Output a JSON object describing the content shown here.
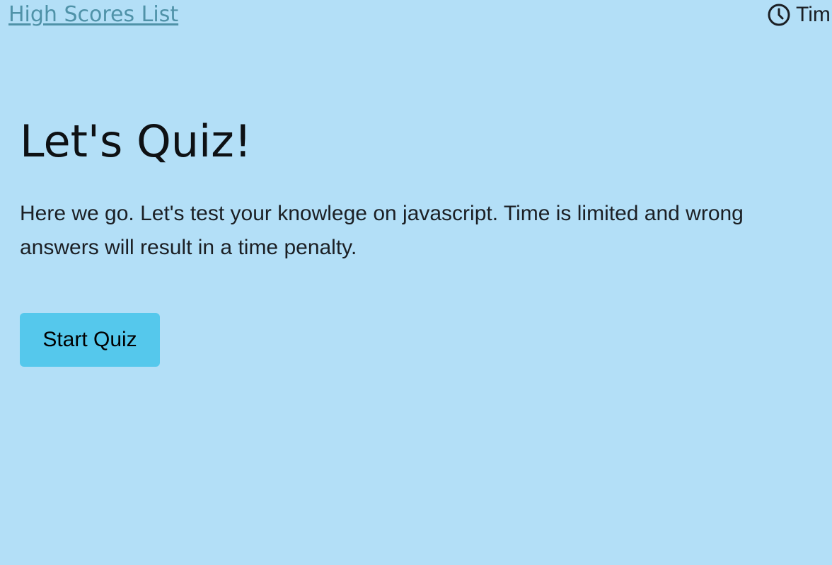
{
  "header": {
    "high_scores_label": "High Scores List",
    "timer_icon": "clock-icon",
    "timer_label": "Tim"
  },
  "main": {
    "title": "Let's Quiz!",
    "intro": "Here we go. Let's test your knowlege on javascript. Time is limited and wrong answers will result in a time penalty.",
    "start_label": "Start Quiz"
  },
  "colors": {
    "background": "#b3dff7",
    "link": "#4f92a8",
    "button": "#55c8ec"
  }
}
